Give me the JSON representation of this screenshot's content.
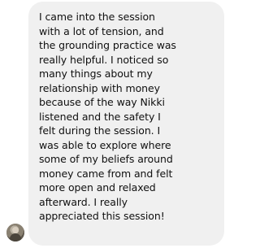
{
  "message": {
    "lines": [
      "I came into the session",
      "with a lot of tension, and",
      "the grounding practice was",
      "really helpful. I noticed so",
      "many things about my",
      "relationship with money",
      "because of the way Nikki",
      "listened and the safety I",
      "felt during the session. I",
      "was able to explore where",
      "some of my beliefs around",
      "money came from and felt",
      "more open and relaxed",
      "afterward. I really",
      "appreciated this session!"
    ]
  },
  "colors": {
    "bubble_background": "#f0f0f0",
    "text": "#101010",
    "page_background": "#ffffff"
  }
}
